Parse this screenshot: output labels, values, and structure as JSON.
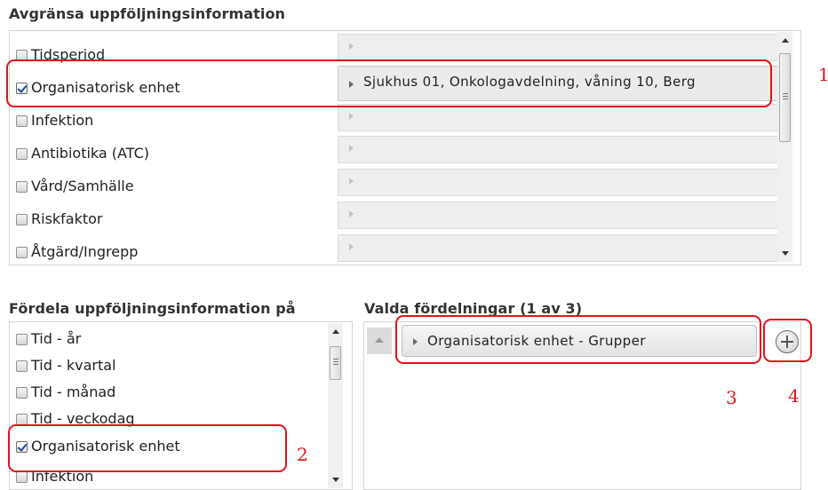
{
  "restrict": {
    "heading": "Avgränsa uppföljningsinformation",
    "items": [
      {
        "label": "Tidsperiod",
        "checked": false,
        "value": ""
      },
      {
        "label": "Organisatorisk enhet",
        "checked": true,
        "value": "Sjukhus 01, Onkologavdelning, våning 10, Berg"
      },
      {
        "label": "Infektion",
        "checked": false,
        "value": ""
      },
      {
        "label": "Antibiotika (ATC)",
        "checked": false,
        "value": ""
      },
      {
        "label": "Vård/Samhälle",
        "checked": false,
        "value": ""
      },
      {
        "label": "Riskfaktor",
        "checked": false,
        "value": ""
      },
      {
        "label": "Åtgärd/Ingrepp",
        "checked": false,
        "value": ""
      }
    ]
  },
  "distribute": {
    "heading": "Fördela uppföljningsinformation på",
    "items": [
      {
        "label": "Tid - år",
        "checked": false
      },
      {
        "label": "Tid - kvartal",
        "checked": false
      },
      {
        "label": "Tid - månad",
        "checked": false
      },
      {
        "label": "Tid - veckodag",
        "checked": false
      },
      {
        "label": "Organisatorisk enhet",
        "checked": true
      },
      {
        "label": "Infektion",
        "checked": false
      }
    ]
  },
  "selected": {
    "heading": "Valda fördelningar (1 av 3)",
    "items": [
      {
        "label": "Organisatorisk enhet - Grupper"
      }
    ]
  },
  "callouts": {
    "c1": "1",
    "c2": "2",
    "c3": "3",
    "c4": "4"
  },
  "colors": {
    "highlight": "#e0141c",
    "checkmark": "#1b4f9a"
  }
}
